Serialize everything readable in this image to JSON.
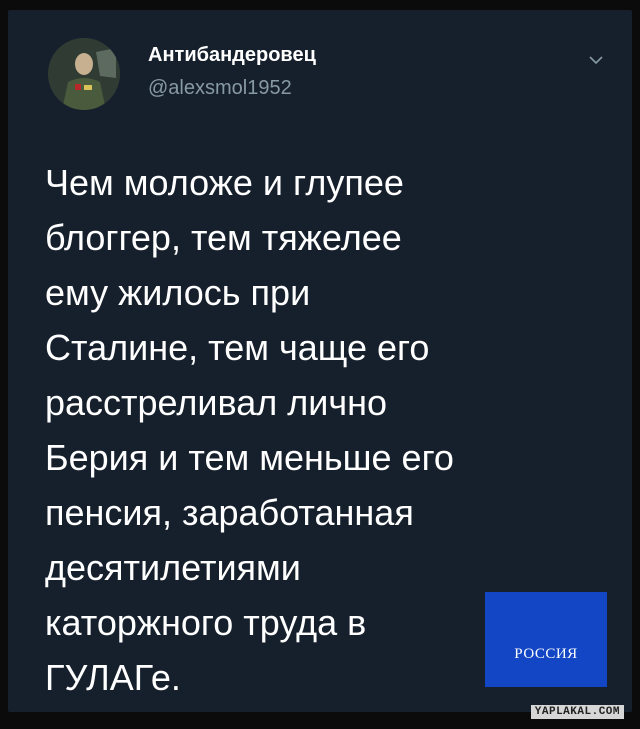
{
  "tweet": {
    "author_name": "Антибандеровец",
    "author_handle": "@alexsmol1952",
    "text": "Чем моложе и глупее\nблоггер, тем тяжелее\nему жилось при\nСталине, тем чаще его\nрасстреливал лично\nБерия  и тем  меньше его\nпенсия, заработанная\nдесятилетиями\nкаторжного труда в\nГУЛАГе."
  },
  "overlay": {
    "channel_label": "РОССИЯ",
    "watermark": "YAPLAKAL.COM"
  },
  "icons": {
    "avatar": "profile-photo",
    "menu": "chevron-down-icon"
  },
  "colors": {
    "background": "#16202c",
    "text": "#ffffff",
    "secondary_text": "#8899a6",
    "channel_blue": "#1246c4"
  }
}
